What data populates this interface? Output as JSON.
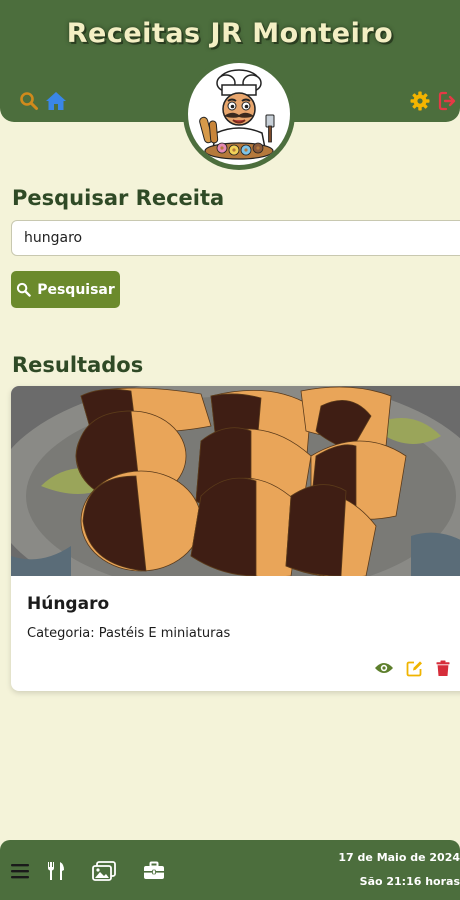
{
  "header": {
    "title": "Receitas JR Monteiro",
    "icons": [
      "search-icon",
      "home-icon",
      "gear-icon",
      "logout-icon"
    ]
  },
  "search": {
    "title": "Pesquisar Receita",
    "value": "hungaro",
    "button_label": "Pesquisar"
  },
  "results": {
    "title": "Resultados",
    "items": [
      {
        "name": "Húngaro",
        "category": "Categoria: Pastéis E miniaturas"
      }
    ]
  },
  "footer": {
    "date": "17 de Maio de 2024",
    "time": "São 21:16 horas",
    "icons": [
      "menu-icon",
      "utensils-icon",
      "images-icon",
      "briefcase-icon"
    ]
  },
  "colors": {
    "primary": "#4c6e3d",
    "background": "#f4f3d9",
    "button": "#6b8a2c",
    "search_icon": "#d08a1c",
    "home_icon": "#3a86e8",
    "gear_icon": "#f4b400",
    "logout_icon": "#e53945",
    "view_icon": "#5d7f2c",
    "edit_icon": "#f0b400",
    "delete_icon": "#d62d3a"
  }
}
